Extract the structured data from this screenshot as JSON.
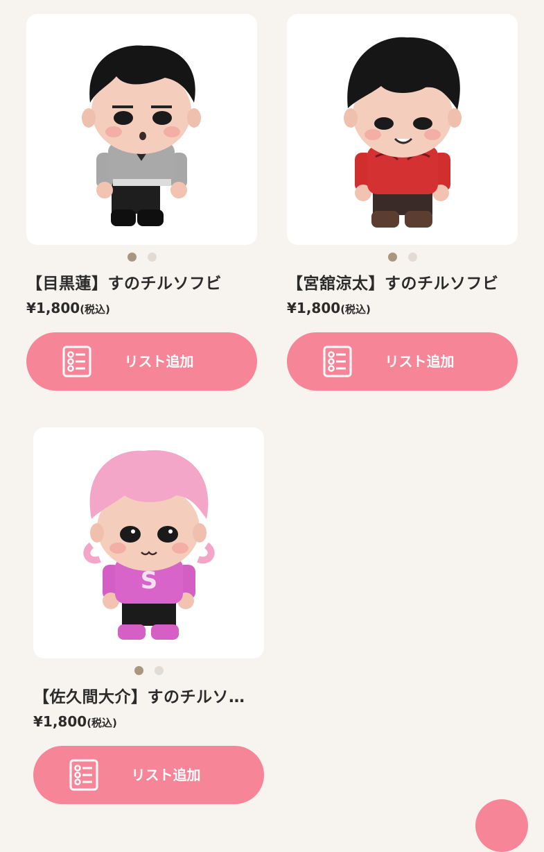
{
  "products": [
    {
      "name": "【目黒蓮】すのチルソフビ",
      "price": "¥1,800",
      "tax": "(税込)",
      "button": "リスト追加"
    },
    {
      "name": "【宮舘涼太】すのチルソフビ",
      "price": "¥1,800",
      "tax": "(税込)",
      "button": "リスト追加"
    },
    {
      "name": "【佐久間大介】すのチルソ…",
      "price": "¥1,800",
      "tax": "(税込)",
      "button": "リスト追加"
    }
  ],
  "icons": {
    "button_icon": "list-icon",
    "dots": "carousel-dots"
  },
  "colors": {
    "accent": "#f78598",
    "background": "#f7f4f0",
    "dot_active": "#a89681",
    "dot_inactive": "#e1dbd3"
  }
}
